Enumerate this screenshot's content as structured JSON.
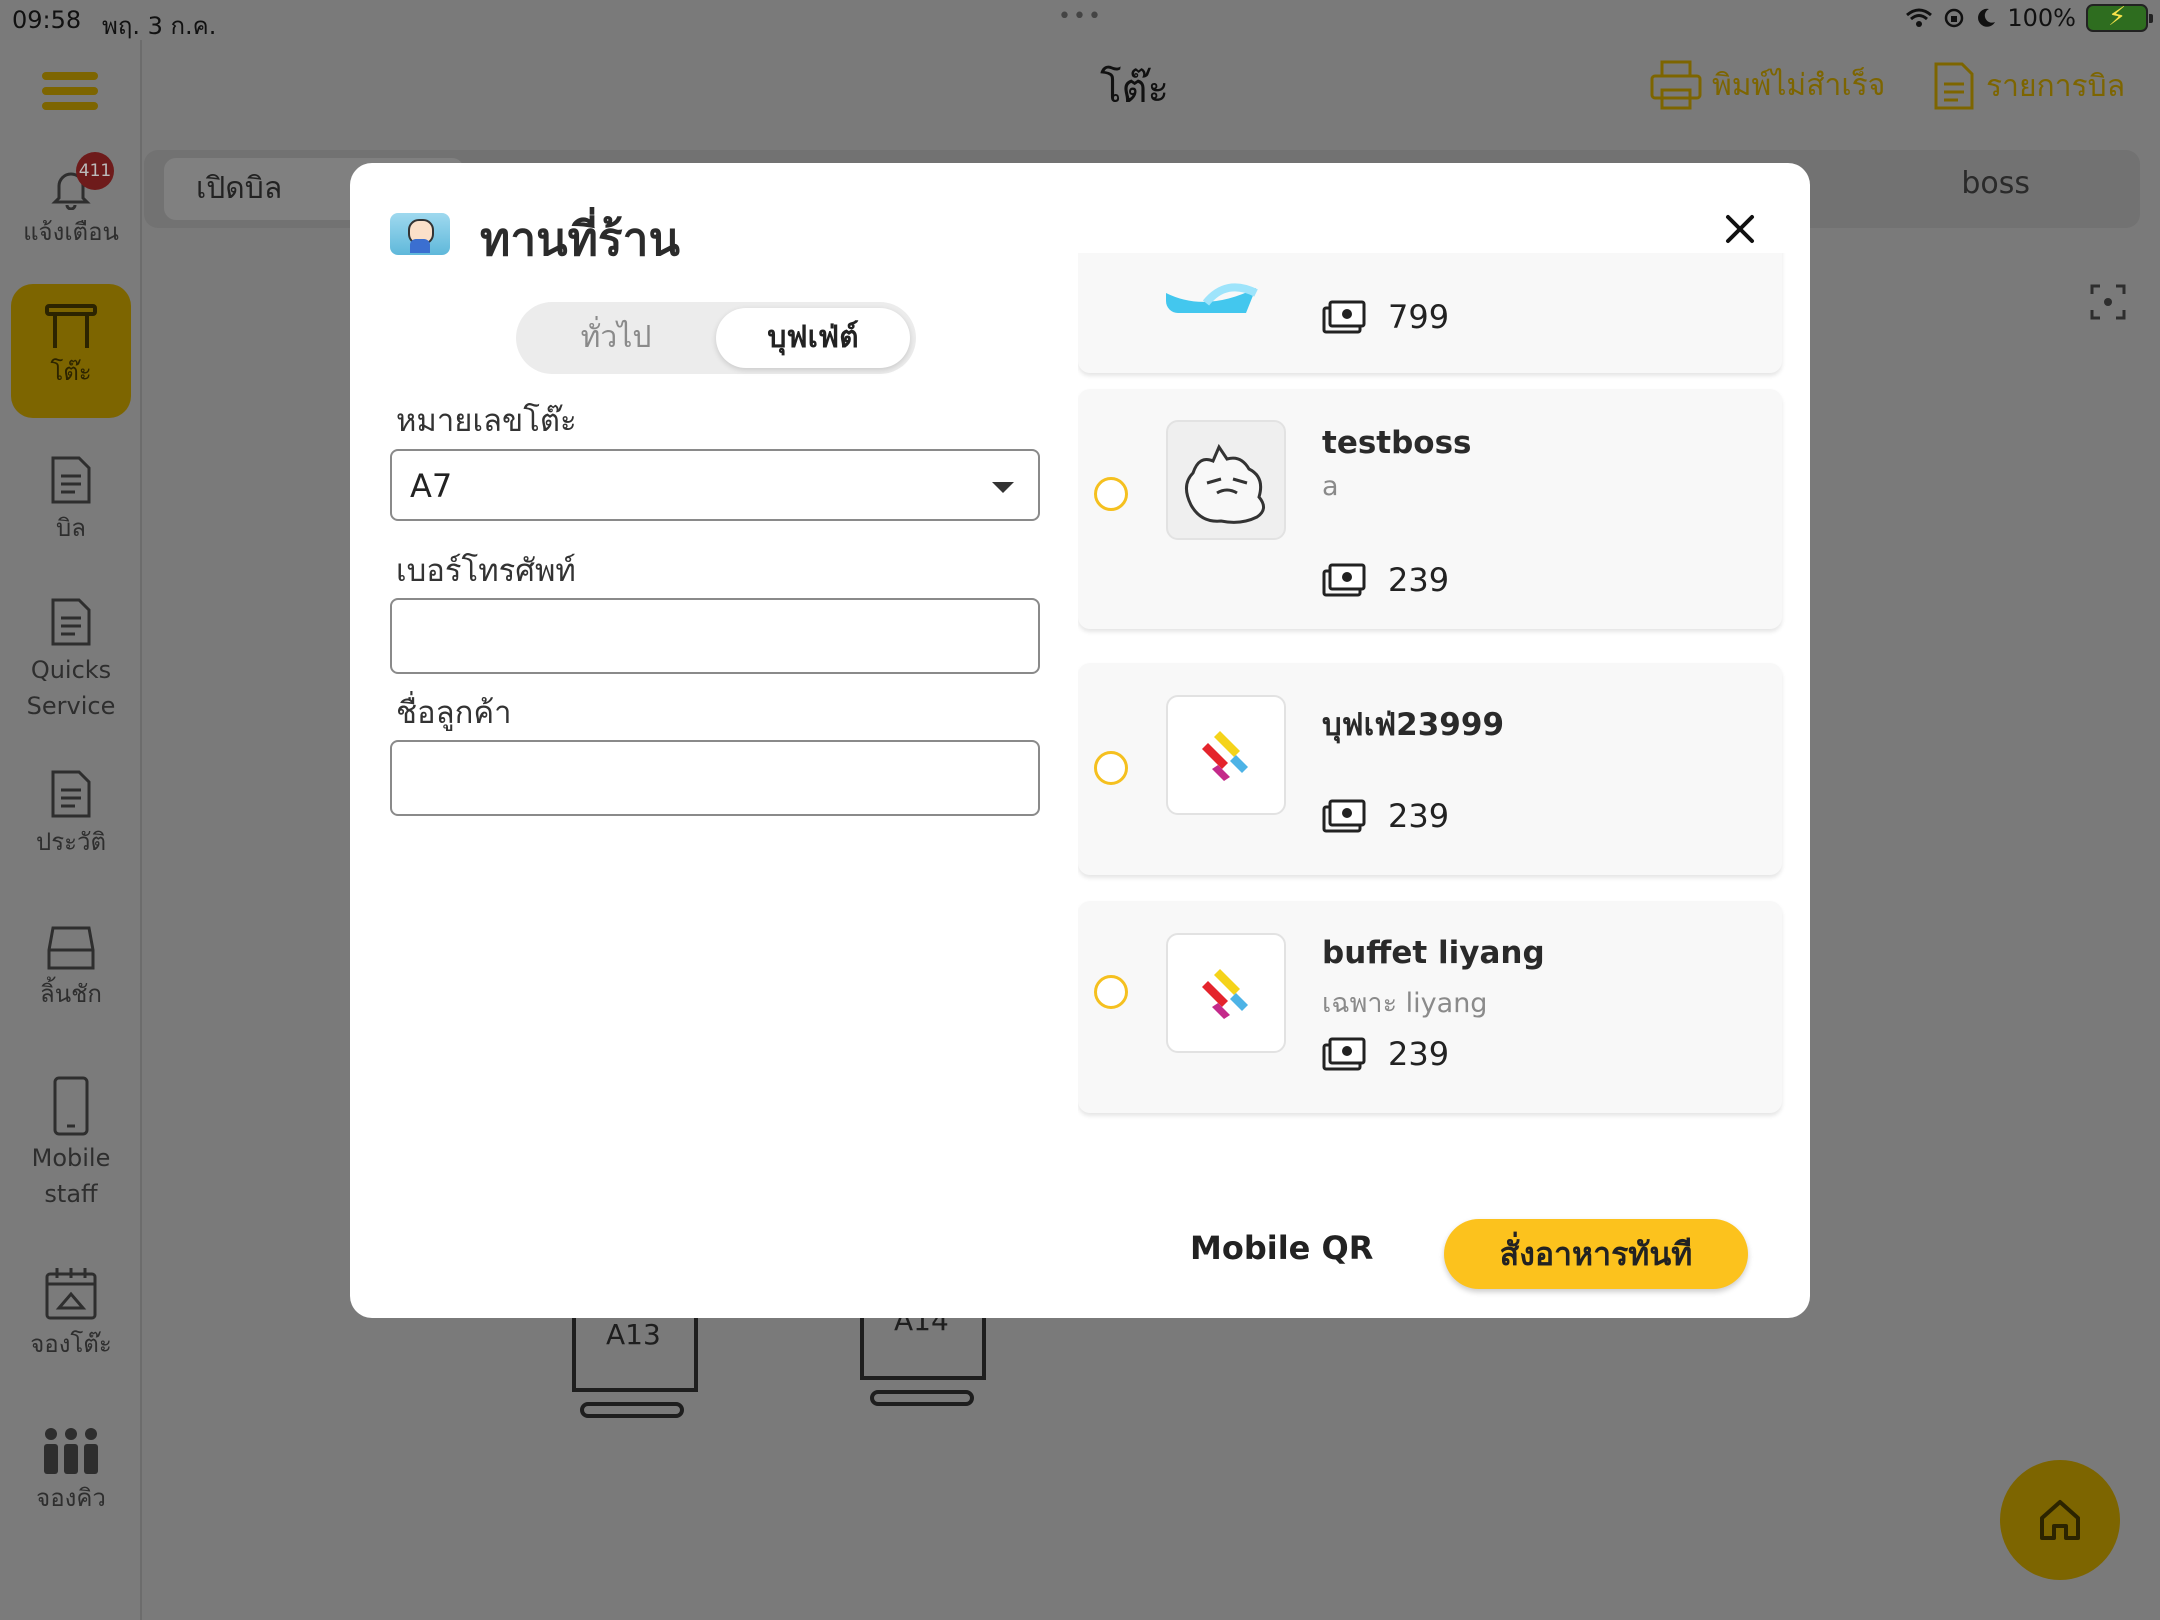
{
  "status_bar": {
    "time": "09:58",
    "date": "พฤ. 3 ก.ค.",
    "dots": "•••",
    "battery": "100%"
  },
  "sidebar": {
    "notification_count": "411",
    "items": [
      {
        "label": "แจ้งเตือน",
        "icon": "bell-icon"
      },
      {
        "label": "โต๊ะ",
        "icon": "table-icon"
      },
      {
        "label": "บิล",
        "icon": "bill-icon"
      },
      {
        "label": "Quicks",
        "label2": "Service",
        "icon": "quick-service-icon"
      },
      {
        "label": "ประวัติ",
        "icon": "history-icon"
      },
      {
        "label": "ลิ้นชัก",
        "icon": "drawer-icon"
      },
      {
        "label": "Mobile",
        "label2": "staff",
        "icon": "mobile-icon"
      },
      {
        "label": "จองโต๊ะ",
        "icon": "calendar-icon"
      },
      {
        "label": "จองคิว",
        "icon": "queue-icon"
      }
    ]
  },
  "header": {
    "title": "โต๊ะ",
    "print_failed": "พิมพ์ไม่สำเร็จ",
    "bill_list": "รายการบิล"
  },
  "tabs": {
    "open_bill": "เปิดบิล",
    "user": "boss"
  },
  "background_tables": [
    {
      "label": "A13"
    },
    {
      "label": "A14"
    }
  ],
  "modal": {
    "title": "ทานที่ร้าน",
    "segments": {
      "general": "ทั่วไป",
      "buffet": "บุฟเฟ่ต์",
      "selected": "buffet"
    },
    "table_number_label": "หมายเลขโต๊ะ",
    "table_number_value": "A7",
    "phone_label": "เบอร์โทรศัพท์",
    "phone_value": "",
    "customer_label": "ชื่อลูกค้า",
    "customer_value": "",
    "buffets": [
      {
        "name": "",
        "desc": "",
        "price": "799"
      },
      {
        "name": "testboss",
        "desc": "a",
        "price": "239"
      },
      {
        "name": "บุฟเฟ่23999",
        "desc": "",
        "price": "239"
      },
      {
        "name": "buffet liyang",
        "desc": "เฉพาะ liyang",
        "price": "239"
      }
    ],
    "mobile_qr": "Mobile QR",
    "order_now": "สั่งอาหารทันที"
  },
  "colors": {
    "accent": "#FCC21D",
    "dim_background": "#7A7A7A"
  }
}
